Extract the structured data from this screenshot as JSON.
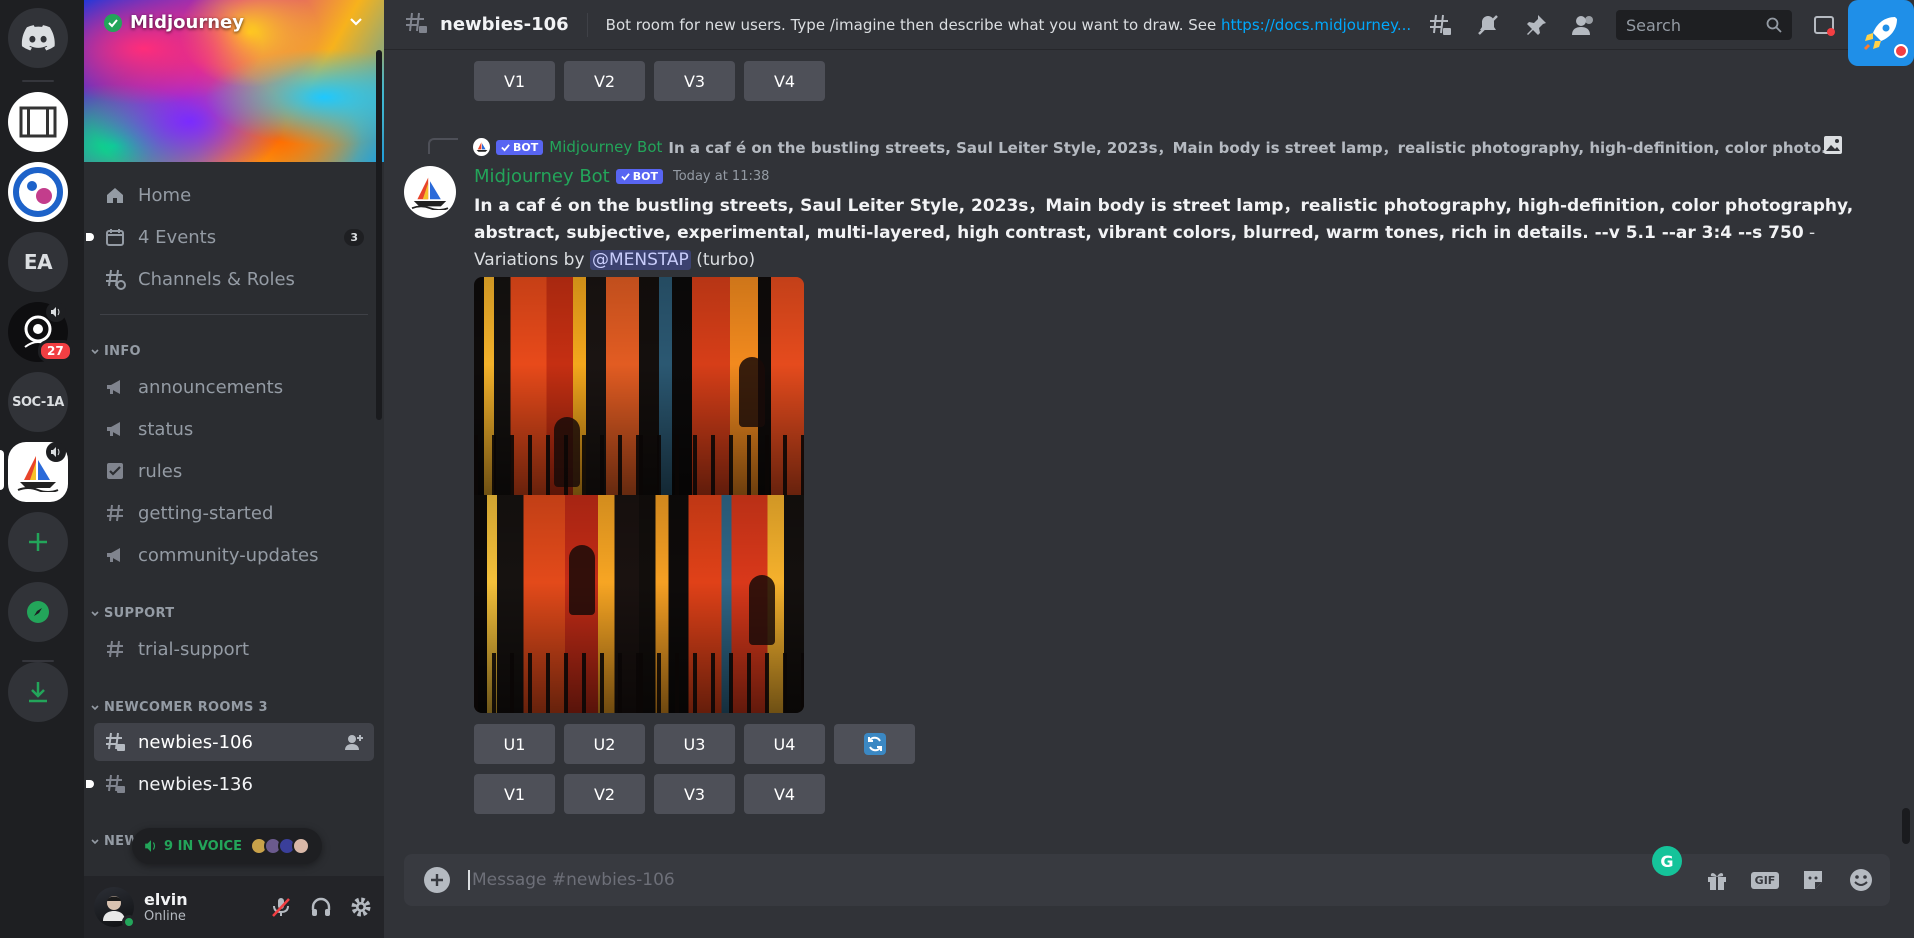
{
  "rail": {
    "servers": [
      {
        "name": "direct-messages"
      },
      {
        "name": "server-1"
      },
      {
        "name": "server-2"
      },
      {
        "name": "server-ea",
        "label": "EA"
      },
      {
        "name": "server-4",
        "badge": "27"
      },
      {
        "name": "server-soc",
        "label": "SOC-1A"
      },
      {
        "name": "server-midjourney"
      }
    ]
  },
  "server": {
    "name": "Midjourney"
  },
  "sidebar": {
    "top_items": [
      {
        "label": "Home",
        "icon": "home-icon"
      },
      {
        "label": "4 Events",
        "icon": "calendar-icon",
        "count": "3"
      },
      {
        "label": "Channels & Roles",
        "icon": "channels-roles-icon"
      }
    ],
    "categories": {
      "info": "INFO",
      "support": "SUPPORT",
      "newcomer": "NEWCOMER ROOMS 3",
      "next": "NEW"
    },
    "info_channels": [
      {
        "label": "announcements",
        "icon": "megaphone-icon"
      },
      {
        "label": "status",
        "icon": "megaphone-icon"
      },
      {
        "label": "rules",
        "icon": "checkbox-icon"
      },
      {
        "label": "getting-started",
        "icon": "hash-icon"
      },
      {
        "label": "community-updates",
        "icon": "megaphone-icon"
      }
    ],
    "support_channels": [
      {
        "label": "trial-support",
        "icon": "hash-icon"
      }
    ],
    "newcomer_channels": [
      {
        "label": "newbies-106",
        "icon": "thread-hash-icon",
        "selected": true
      },
      {
        "label": "newbies-136",
        "icon": "thread-hash-icon",
        "selected": false
      }
    ],
    "voice_pill": "9 IN VOICE"
  },
  "user": {
    "name": "elvin",
    "status": "Online"
  },
  "topbar": {
    "channel": "newbies-106",
    "topic_text": "Bot room for new users. Type /imagine then describe what you want to draw. See ",
    "topic_link": "https://docs.midjourney...",
    "search_placeholder": "Search"
  },
  "messages": {
    "prev_buttons": [
      "V1",
      "V2",
      "V3",
      "V4"
    ],
    "reply": {
      "bot_tag": "BOT",
      "author": "Midjourney Bot",
      "text": "In a caf é on the bustling streets, Saul Leiter Style, 2023s，Main body is street lamp，realistic photography, high-definition, color photography, ab"
    },
    "main": {
      "author": "Midjourney Bot",
      "bot_tag": "BOT",
      "timestamp": "Today at 11:38",
      "prompt": "In a caf é on the bustling streets, Saul Leiter Style, 2023s，Main body is street lamp，realistic photography, high-definition, color photography, abstract, subjective, experimental, multi-layered, high contrast, vibrant colors, blurred, warm tones, rich in details. --v 5.1 --ar 3:4 --s 750",
      "suffix": " - Variations by ",
      "mention": "@MENSTAP",
      "mode": " (turbo)",
      "upscale_buttons": [
        "U1",
        "U2",
        "U3",
        "U4"
      ],
      "variation_buttons": [
        "V1",
        "V2",
        "V3",
        "V4"
      ]
    }
  },
  "composer": {
    "placeholder": "Message #newbies-106",
    "grammarly": "G",
    "gif_label": "GIF"
  },
  "colors": {
    "accent_green": "#23a55a",
    "blurple": "#5865f2",
    "link": "#00a8fc",
    "bg_main": "#313338"
  }
}
